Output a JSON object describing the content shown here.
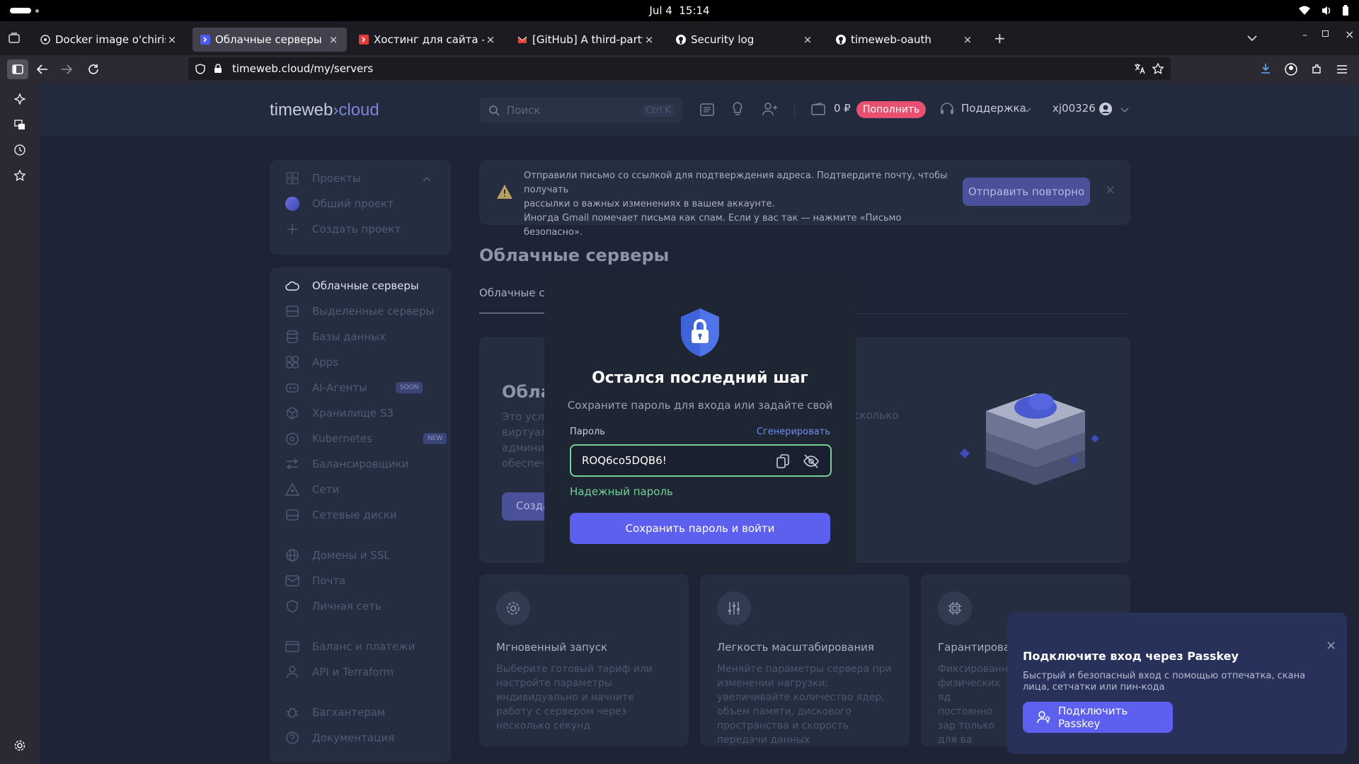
{
  "os_bar": {
    "date": "Jul 4",
    "time": "15:14"
  },
  "tabs": [
    {
      "title": "Docker image o'chirish",
      "icon": "openai-icon",
      "active": false
    },
    {
      "title": "Облачные серверы",
      "icon": "timeweb-icon",
      "active": true
    },
    {
      "title": "Хостинг для сайта - купи",
      "icon": "timeweb-red-icon",
      "active": false
    },
    {
      "title": "[GitHub] A third-party OA",
      "icon": "gmail-icon",
      "active": false
    },
    {
      "title": "Security log",
      "icon": "github-icon",
      "active": false
    },
    {
      "title": "timeweb-oauth",
      "icon": "github-icon",
      "active": false
    }
  ],
  "browser": {
    "url": "timeweb.cloud/my/servers"
  },
  "header": {
    "logo_left": "timeweb",
    "logo_right": "cloud",
    "search_placeholder": "Поиск",
    "search_shortcut": "Ctrl K",
    "balance": "0 ₽",
    "topup_label": "Пополнить",
    "support_label": "Поддержка",
    "username": "xj00326"
  },
  "projects": {
    "title": "Проекты",
    "items": [
      "Общий проект",
      "Создать проект"
    ]
  },
  "nav": {
    "items": [
      {
        "label": "Облачные серверы",
        "icon": "cloud-icon"
      },
      {
        "label": "Выделенные серверы",
        "icon": "server-icon"
      },
      {
        "label": "Базы данных",
        "icon": "database-icon"
      },
      {
        "label": "Apps",
        "icon": "apps-icon"
      },
      {
        "label": "AI-Агенты",
        "icon": "robot-icon",
        "badge": "SOON"
      },
      {
        "label": "Хранилище S3",
        "icon": "cube-icon"
      },
      {
        "label": "Kubernetes",
        "icon": "kubernetes-icon",
        "badge": "NEW"
      },
      {
        "label": "Балансировщики",
        "icon": "balancer-icon"
      },
      {
        "label": "Сети",
        "icon": "network-icon"
      },
      {
        "label": "Сетевые диски",
        "icon": "disk-icon"
      },
      {
        "label": "Домены и SSL",
        "icon": "globe-icon"
      },
      {
        "label": "Почта",
        "icon": "mail-icon"
      },
      {
        "label": "Личная сеть",
        "icon": "shield-icon"
      },
      {
        "label": "Баланс и платежи",
        "icon": "wallet-icon"
      },
      {
        "label": "API и Terraform",
        "icon": "api-icon"
      },
      {
        "label": "Багхантерам",
        "icon": "bug-icon"
      },
      {
        "label": "Документация",
        "icon": "help-icon"
      }
    ]
  },
  "alert": {
    "line1": "Отправили письмо со ссылкой для подтверждения адреса. Подтвердите почту, чтобы получать",
    "line2": "рассылки о важных изменениях в вашем аккаунте.",
    "line3": "Иногда Gmail помечает письма как спам. Если у вас так — нажмите «Письмо безопасно».",
    "resend_label": "Отправить повторно"
  },
  "page": {
    "title": "Облачные серверы",
    "tab_label": "Облачные се",
    "hero_title": "Обла",
    "hero_text": [
      "Это услу",
      "виртуаль",
      "админис",
      "обеспеч"
    ],
    "hero_right": "есколько",
    "create_button": "Созда"
  },
  "features": [
    {
      "title": "Мгновенный запуск",
      "icon": "gear-icon",
      "text": "Выберите готовый тариф или настройте параметры индивидуально и начните работу с сервером через несколько секунд"
    },
    {
      "title": "Легкость масштабирования",
      "icon": "sliders-icon",
      "text": "Меняйте параметры сервера при изменении нагрузки: увеличивайте количество ядер, объем памяти, дискового пространства и скорость передачи данных"
    },
    {
      "title": "Гарантирован",
      "icon": "cpu-icon",
      "text": "Фиксированн физических яд постоянно зар только для ва"
    }
  ],
  "modal": {
    "title": "Остался последний шаг",
    "subtitle": "Сохраните пароль для входа или задайте свой",
    "password_label": "Пароль",
    "generate_label": "Сгенерировать",
    "password_value": "ROQ6co5DQB6!",
    "strength_label": "Надежный пароль",
    "submit_label": "Сохранить пароль и войти"
  },
  "toast": {
    "title": "Подключите вход через Passkey",
    "text": "Быстрый и безопасный вход с помощью отпечатка, скана лица, сетчатки или пин-кода",
    "button_label": "Подключить Passkey"
  },
  "colors": {
    "accent": "#5d5fef",
    "success": "#72d39a",
    "topup": "#e8506f",
    "bg": "#1e2436"
  }
}
